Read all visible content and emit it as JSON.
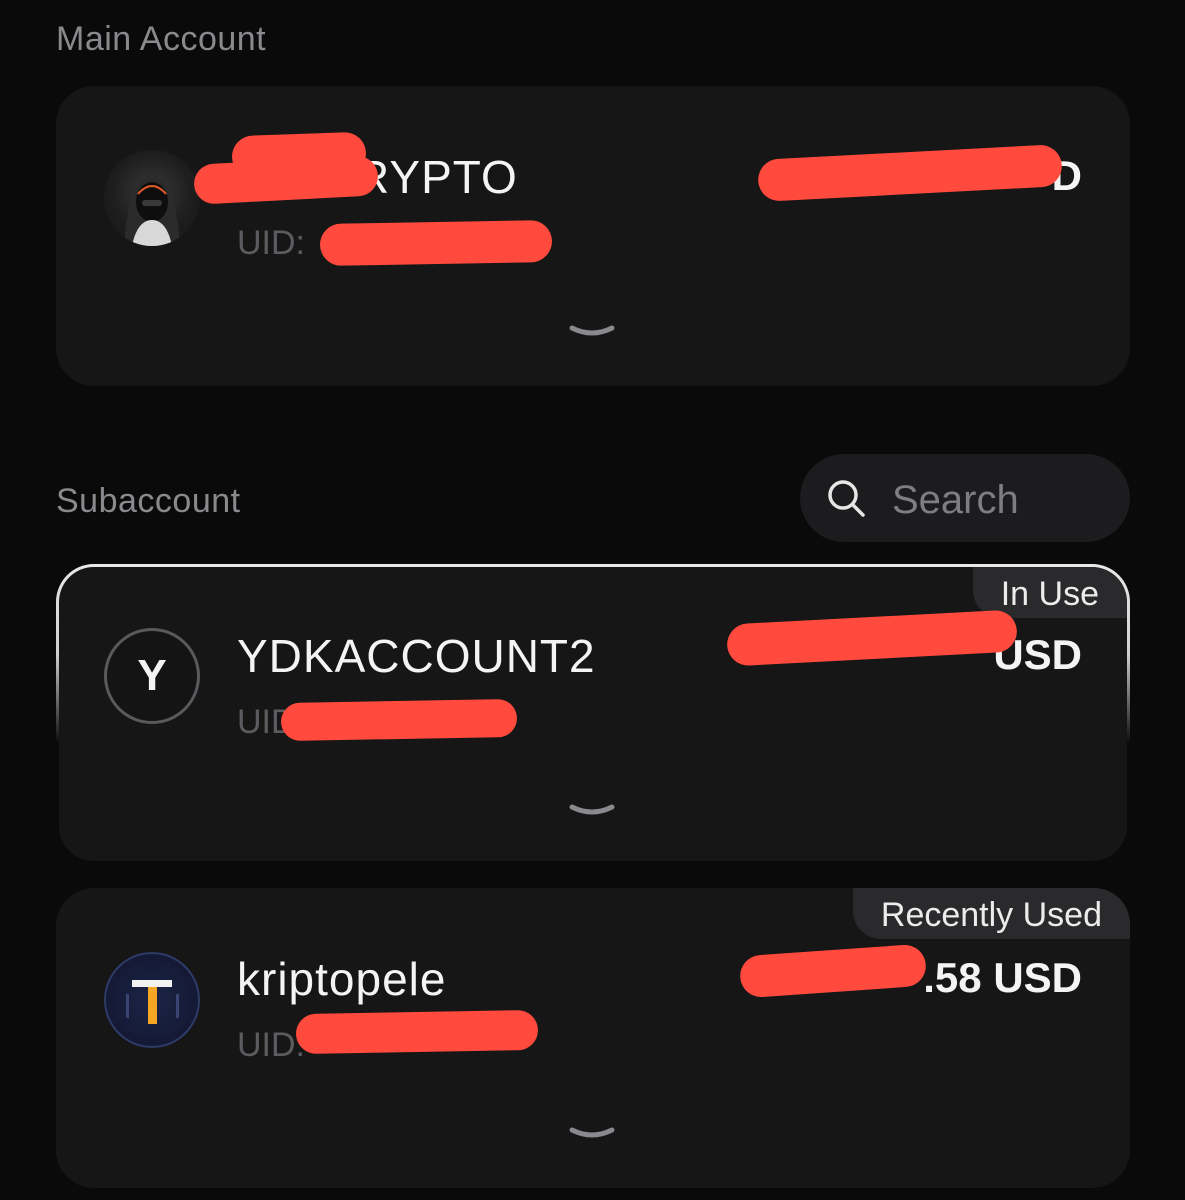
{
  "main_section": {
    "title": "Main Account"
  },
  "main_account": {
    "name_suffix": "RYPTO",
    "uid_label": "UID:",
    "balance_suffix": "D"
  },
  "sub_section": {
    "title": "Subaccount",
    "search_placeholder": "Search"
  },
  "subaccounts": [
    {
      "avatar_letter": "Y",
      "name": "YDKACCOUNT2",
      "uid_label": "UID",
      "balance_suffix": "USD",
      "tag": "In Use"
    },
    {
      "avatar_letter": "T",
      "name": "kriptopele",
      "uid_label": "UID:",
      "balance_suffix": ".58 USD",
      "tag": "Recently Used"
    }
  ],
  "colors": {
    "background": "#0a0a0a",
    "card": "#161617",
    "redaction": "#ff4a3d",
    "muted_text": "#8a8a8e",
    "accent_gold": "#f5a623"
  }
}
